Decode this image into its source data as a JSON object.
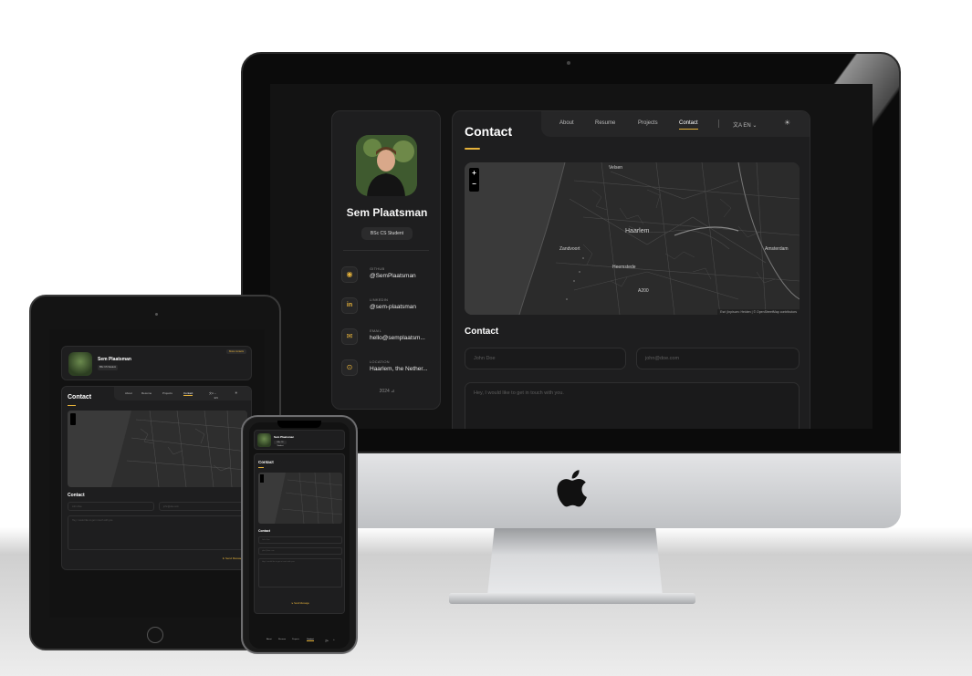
{
  "site": {
    "name": "Sem Plaatsman",
    "role": "BSc CS Student",
    "footer": "2024 ⊿"
  },
  "nav": {
    "items": [
      "About",
      "Resume",
      "Projects",
      "Contact"
    ],
    "active": "Contact",
    "language": "EN",
    "lang_icon": "translate-icon",
    "theme_icon": "sun-icon"
  },
  "contacts": [
    {
      "label": "GITHUB",
      "value": "@SemPlaatsman",
      "icon": "github-icon"
    },
    {
      "label": "LINKEDIN",
      "value": "@sem-plaatsman",
      "icon": "linkedin-icon"
    },
    {
      "label": "EMAIL",
      "value": "hello@semplaatsm...",
      "icon": "mail-icon"
    },
    {
      "label": "LOCATION",
      "value": "Haarlem, the Nether...",
      "icon": "location-icon"
    }
  ],
  "page": {
    "title": "Contact"
  },
  "map": {
    "zoom_in": "+",
    "zoom_out": "−",
    "attribution": "Esri (Inpisum: Heiden | © OpenStreetMap contributors",
    "labels": [
      "Haarlem",
      "Zandvoort",
      "Amsterdam",
      "Heemstede",
      "Velsen",
      "A200"
    ]
  },
  "form": {
    "title": "Contact",
    "name_placeholder": "John Doe",
    "email_placeholder": "john@doe.com",
    "message_placeholder": "Hey, I would like to get in touch with you.",
    "send_label": "Send Message",
    "send_icon": "send-icon"
  },
  "ipad": {
    "show_contacts": "Show contacts"
  },
  "colors": {
    "accent": "#e6b23a",
    "panel": "#1e1e1f",
    "background": "#131313"
  }
}
